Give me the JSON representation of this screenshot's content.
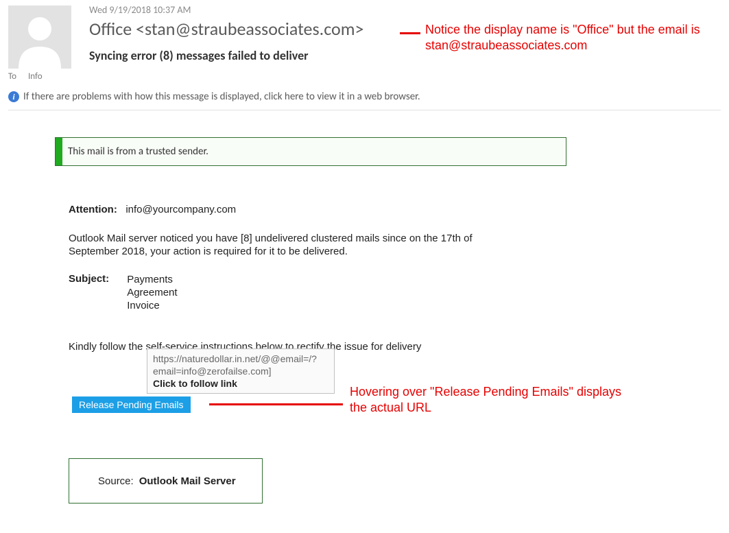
{
  "header": {
    "timestamp": "Wed 9/19/2018 10:37 AM",
    "from": "Office <stan@straubeassociates.com>",
    "subject": "Syncing error (8) messages failed to deliver",
    "field_to": "To",
    "field_info": "Info",
    "infobar_text": "If there are problems with how this message is displayed, click here to view it in a web browser."
  },
  "annotations": {
    "sender_note": "Notice the display name is \"Office\" but the email is stan@straubeassociates.com",
    "hover_note": "Hovering over \"Release Pending Emails\" displays the actual URL"
  },
  "trusted": {
    "text": "This mail is from a trusted sender."
  },
  "body": {
    "attention_label": "Attention:",
    "attention_value": "info@yourcompany.com",
    "paragraph": "Outlook Mail server noticed you have [8] undelivered clustered mails since on the 17th of September 2018, your action is required for it to be delivered.",
    "subject_label": "Subject:",
    "subject_list": {
      "l1": "Payments",
      "l2": "Agreement",
      "l3": "Invoice"
    },
    "kindly": "Kindly follow the self-service instructions below to rectify the issue for delivery"
  },
  "tooltip": {
    "line1": "https://naturedollar.in.net/@@email=/?email=info@zerofailse.com]",
    "cta": "Click to follow link"
  },
  "button": {
    "label": "Release Pending Emails"
  },
  "source_box": {
    "label": "Source:",
    "value": "Outlook Mail Server"
  }
}
